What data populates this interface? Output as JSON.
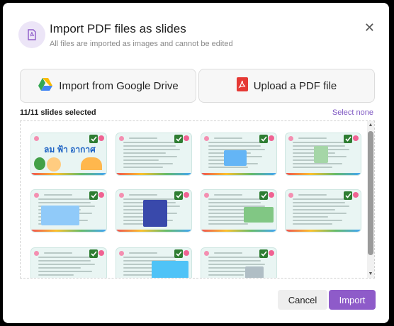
{
  "dialog": {
    "title": "Import PDF files as slides",
    "subtitle": "All files are imported as images and cannot be edited",
    "close_icon": "close-icon",
    "header_icon": "pdf-file-icon"
  },
  "sources": {
    "google_drive_label": "Import from Google Drive",
    "google_drive_icon": "google-drive-icon",
    "upload_pdf_label": "Upload a PDF file",
    "upload_pdf_icon": "pdf-icon"
  },
  "selection": {
    "count_label": "11/11 slides selected",
    "select_none_label": "Select none"
  },
  "slides": [
    {
      "selected": true,
      "thumb_title": "ลม ฟ้า อากาศ"
    },
    {
      "selected": true
    },
    {
      "selected": true
    },
    {
      "selected": true
    },
    {
      "selected": true
    },
    {
      "selected": true
    },
    {
      "selected": true
    },
    {
      "selected": true
    },
    {
      "selected": true
    },
    {
      "selected": true
    },
    {
      "selected": true
    }
  ],
  "footer": {
    "cancel_label": "Cancel",
    "import_label": "Import"
  },
  "colors": {
    "accent": "#8e5bc9",
    "check": "#2e7d32",
    "select_none": "#7e57c2"
  }
}
